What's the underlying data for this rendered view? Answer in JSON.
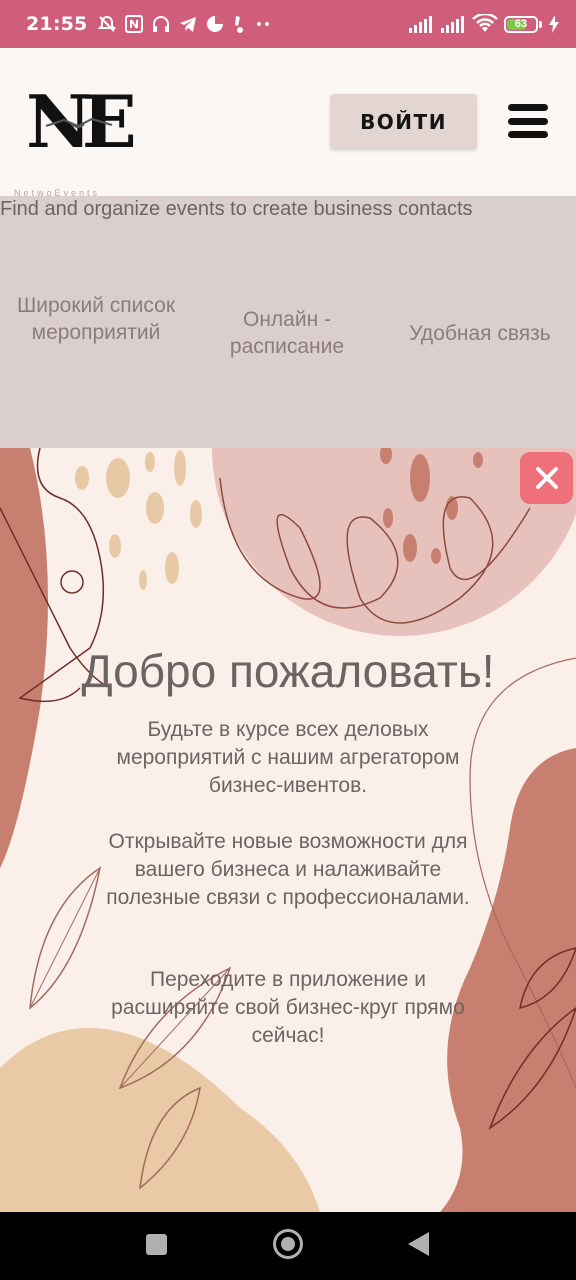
{
  "status_bar": {
    "time": "21:55",
    "battery": "63",
    "accent": "#d05d7a",
    "left_icons": [
      "mute-icon",
      "nfc-icon",
      "headphones-icon",
      "telegram-icon",
      "app-icon",
      "notification-icon",
      "more-dots-icon"
    ],
    "right_icons": [
      "signal-icon",
      "signal-icon",
      "wifi-icon",
      "battery-icon",
      "charging-icon"
    ]
  },
  "header": {
    "logo_letters": "NE",
    "logo_tagline": "NetwoEvents",
    "login_label": "ВОЙТИ",
    "menu_icon": "hamburger-menu-icon"
  },
  "features": {
    "tagline": "Find and organize events to create business contacts",
    "items": [
      {
        "label": "Широкий список мероприятий"
      },
      {
        "label": "Онлайн - расписание"
      },
      {
        "label": "Удобная связь"
      }
    ]
  },
  "modal": {
    "close_icon": "close-icon",
    "close_color": "#ef6f7a",
    "title": "Добро пожаловать!",
    "paragraphs": [
      "Будьте в курсе всех деловых мероприятий с нашим агрегатором бизнес-ивентов.",
      "Открывайте новые возможности для вашего бизнеса и налаживайте полезные связи с профессионалами.",
      "Переходите в приложение и расширяйте свой бизнес-круг прямо сейчас!"
    ]
  },
  "nav_bar": {
    "icons": [
      "recent-apps-icon",
      "home-icon",
      "back-icon"
    ]
  }
}
